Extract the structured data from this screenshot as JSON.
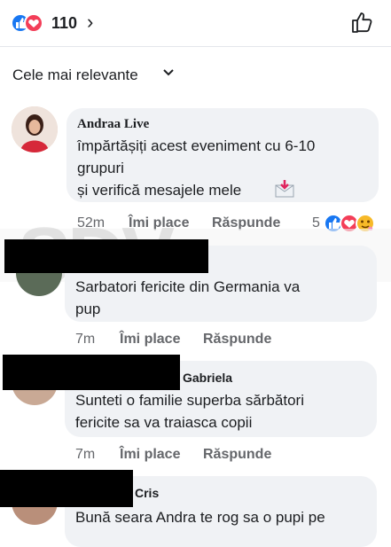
{
  "reactions": {
    "count": "110",
    "chevron": "›"
  },
  "sort": {
    "label": "Cele mai relevante"
  },
  "comments": [
    {
      "name": "Andraa Live",
      "lines": [
        "împărtășiți acest eveniment cu 6-10",
        "grupuri",
        "și verifică mesajele mele"
      ],
      "time": "52m",
      "like": "Îmi place",
      "reply": "Răspunde",
      "reaction_count": "5"
    },
    {
      "name": "",
      "lines": [
        "Sarbatori fericite din Germania va",
        "pup"
      ],
      "time": "7m",
      "like": "Îmi place",
      "reply": "Răspunde"
    },
    {
      "name": "Gabriela",
      "lines": [
        "Sunteti o familie superba sărbători",
        "fericite sa va traiasca copii"
      ],
      "time": "7m",
      "like": "Îmi place",
      "reply": "Răspunde"
    },
    {
      "name": "Cris",
      "lines": [
        "Bună seara Andra te rog sa o pupi pe"
      ]
    }
  ],
  "watermark": "SDV",
  "colors": {
    "like_blue": "#1877f2",
    "love_red": "#f33e58",
    "meta_gray": "#65676b",
    "bubble": "#f0f2f5"
  }
}
